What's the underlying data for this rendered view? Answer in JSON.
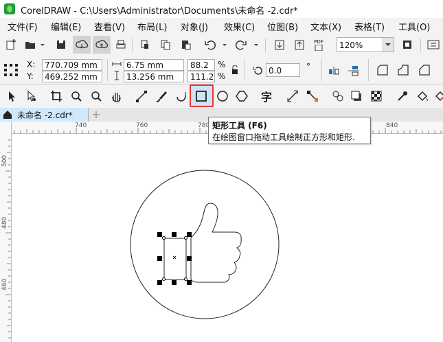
{
  "window": {
    "title": "CorelDRAW - C:\\Users\\Administrator\\Documents\\未命名 -2.cdr*"
  },
  "menu": {
    "items": [
      {
        "label": "文件(F)"
      },
      {
        "label": "编辑(E)"
      },
      {
        "label": "查看(V)"
      },
      {
        "label": "布局(L)"
      },
      {
        "label": "对象(J)"
      },
      {
        "label": "效果(C)"
      },
      {
        "label": "位图(B)"
      },
      {
        "label": "文本(X)"
      },
      {
        "label": "表格(T)"
      },
      {
        "label": "工具(O)"
      }
    ]
  },
  "standard_toolbar": {
    "zoom_value": "120%",
    "pdf_label": "PDF"
  },
  "property_bar": {
    "x_label": "X:",
    "x_value": "770.709 mm",
    "y_label": "Y:",
    "y_value": "469.252 mm",
    "width_value": "6.75 mm",
    "height_value": "13.256 mm",
    "scale_x": "88.2",
    "scale_y": "111.2",
    "percent": "%",
    "rotation_value": "0.0",
    "degree": "°"
  },
  "document": {
    "tab_label": "未命名 -2.cdr*"
  },
  "ruler": {
    "h_ticks": [
      "740",
      "760",
      "780",
      "840"
    ],
    "v_ticks": [
      "500",
      "480",
      "460"
    ]
  },
  "tooltip": {
    "title": "矩形工具 (F6)",
    "body": "在绘图窗口拖动工具绘制正方形和矩形."
  },
  "toolbox": {
    "text_tool_glyph": "字"
  },
  "colors": {
    "highlight": "#e53935",
    "accent": "#0063b1"
  }
}
